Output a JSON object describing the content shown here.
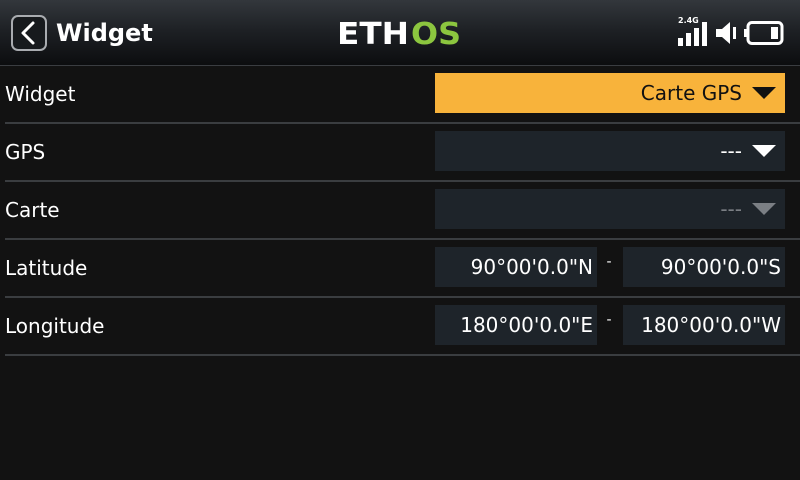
{
  "header": {
    "title": "Widget",
    "brand_prefix": "ETH",
    "brand_suffix": "OS",
    "rf_label": "2.4G",
    "back_icon": "chevron-left-icon",
    "status_icons": [
      "signal-bars-icon",
      "volume-icon",
      "battery-icon"
    ],
    "colors": {
      "brand_main": "#ffffff",
      "brand_accent": "#8cc63f"
    }
  },
  "form": {
    "widget": {
      "label": "Widget",
      "value": "Carte GPS"
    },
    "gps": {
      "label": "GPS",
      "value": "---"
    },
    "map": {
      "label": "Carte",
      "value": "---",
      "disabled": true
    },
    "latitude": {
      "label": "Latitude",
      "min": "90°00'0.0\"N",
      "separator": "-",
      "max": "90°00'0.0\"S"
    },
    "longitude": {
      "label": "Longitude",
      "min": "180°00'0.0\"E",
      "separator": "-",
      "max": "180°00'0.0\"W"
    }
  },
  "colors": {
    "accent": "#f8b33b",
    "field_bg": "#1e242a",
    "background": "#121212"
  }
}
